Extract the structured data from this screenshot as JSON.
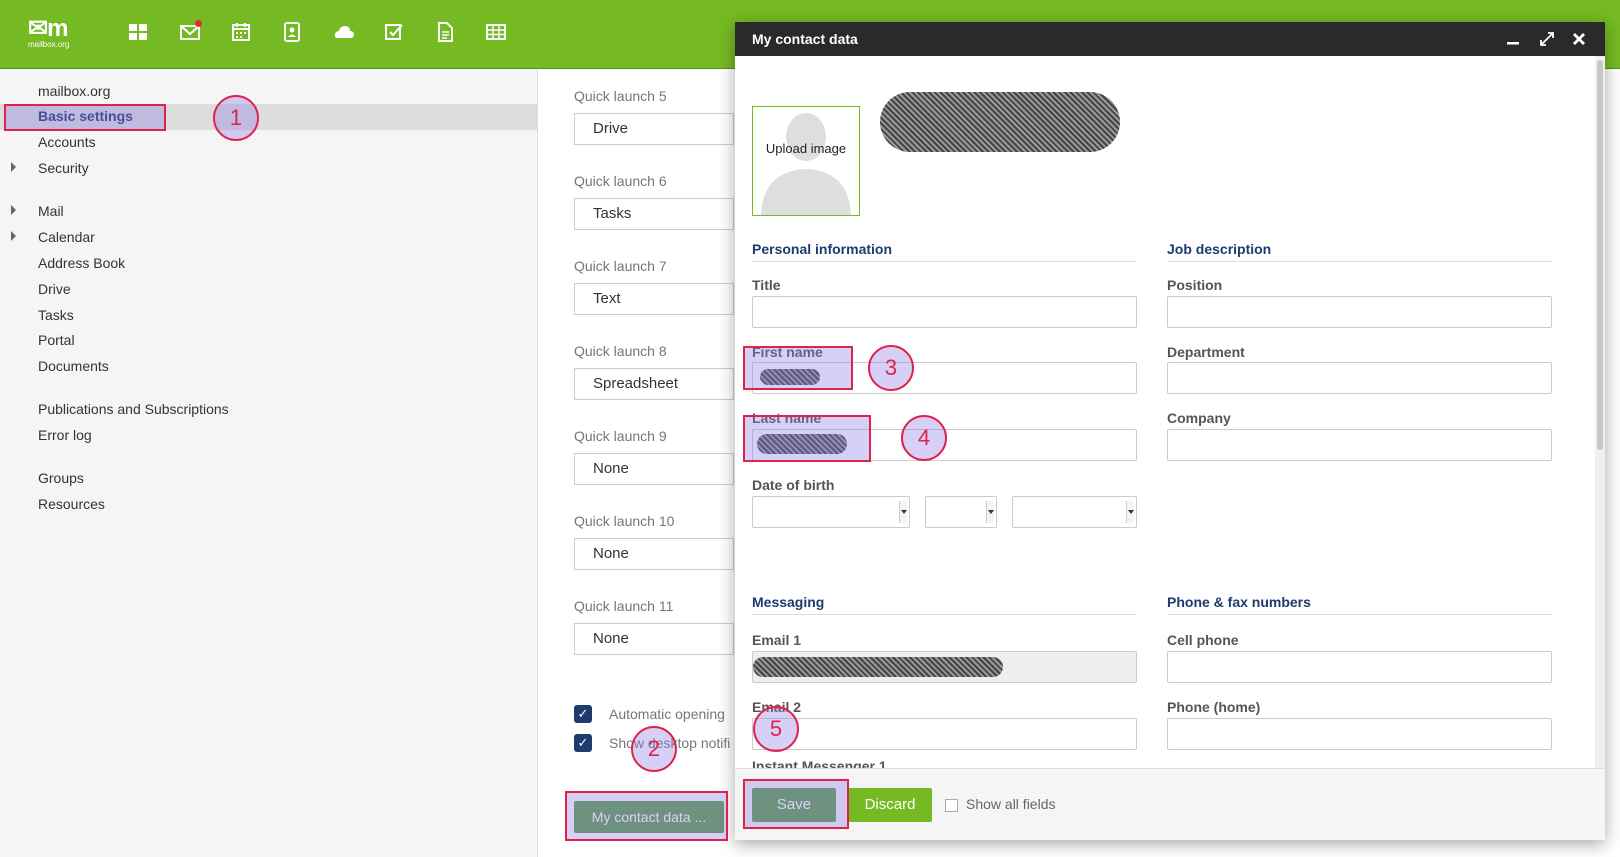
{
  "app": {
    "logo_text": "m",
    "logo_sub": "mailbox.org",
    "apps": [
      {
        "name": "portal-icon"
      },
      {
        "name": "mail-icon",
        "badge": true
      },
      {
        "name": "calendar-icon"
      },
      {
        "name": "address-book-icon"
      },
      {
        "name": "drive-icon"
      },
      {
        "name": "tasks-icon"
      },
      {
        "name": "text-icon"
      },
      {
        "name": "spreadsheet-icon"
      }
    ]
  },
  "sidebar": {
    "items": [
      {
        "label": "mailbox.org"
      },
      {
        "label": "Basic settings",
        "selected": true
      },
      {
        "label": "Accounts"
      },
      {
        "label": "Security",
        "expandable": true
      },
      {
        "label": "Mail",
        "expandable": true
      },
      {
        "label": "Calendar",
        "expandable": true
      },
      {
        "label": "Address Book"
      },
      {
        "label": "Drive"
      },
      {
        "label": "Tasks"
      },
      {
        "label": "Portal"
      },
      {
        "label": "Documents"
      },
      {
        "label": "Publications and Subscriptions"
      },
      {
        "label": "Error log"
      },
      {
        "label": "Groups"
      },
      {
        "label": "Resources"
      }
    ]
  },
  "main": {
    "quick_launch": [
      {
        "label": "Quick launch 5",
        "value": "Drive"
      },
      {
        "label": "Quick launch 6",
        "value": "Tasks"
      },
      {
        "label": "Quick launch 7",
        "value": "Text"
      },
      {
        "label": "Quick launch 8",
        "value": "Spreadsheet"
      },
      {
        "label": "Quick launch 9",
        "value": "None"
      },
      {
        "label": "Quick launch 10",
        "value": "None"
      },
      {
        "label": "Quick launch 11",
        "value": "None"
      }
    ],
    "checkboxes": [
      {
        "label": "Automatic opening",
        "checked": true
      },
      {
        "label": "Show desktop notifi",
        "checked": true
      }
    ],
    "contact_button": "My contact data ..."
  },
  "dialog": {
    "title": "My contact data",
    "upload_label": "Upload image",
    "personal_section": "Personal information",
    "job_section": "Job description",
    "messaging_section": "Messaging",
    "phone_section": "Phone & fax numbers",
    "labels": {
      "title": "Title",
      "first_name": "First name",
      "last_name": "Last name",
      "dob": "Date of birth",
      "position": "Position",
      "department": "Department",
      "company": "Company",
      "email1": "Email 1",
      "email2": "Email 2",
      "im1": "Instant Messenger 1",
      "cell": "Cell phone",
      "phone_home": "Phone (home)"
    },
    "save_label": "Save",
    "discard_label": "Discard",
    "show_all_label": "Show all fields"
  },
  "annotations": [
    "1",
    "2",
    "3",
    "4",
    "5"
  ],
  "colors": {
    "topbar": "#75ba23",
    "accent_dark": "#60a04a",
    "section_title": "#1e3a6e",
    "annotation": "#e0224b"
  }
}
